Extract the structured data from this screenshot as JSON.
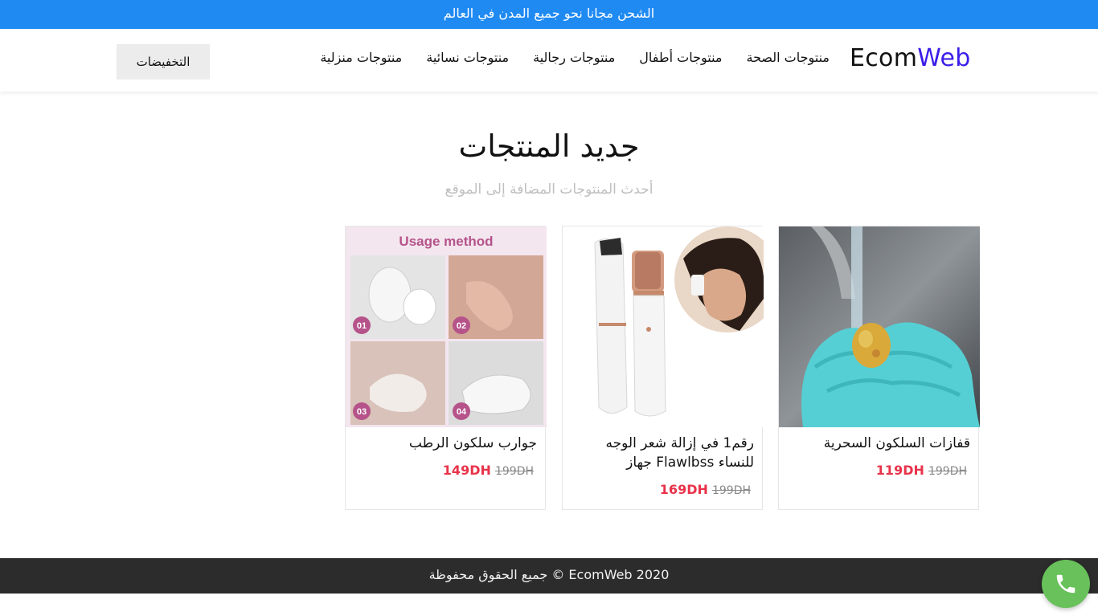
{
  "topbar": {
    "text": "الشحن مجانا نحو جميع المدن في العالم"
  },
  "header": {
    "logo_part1": "Ecom",
    "logo_part2": "Web",
    "nav": [
      "منتوجات منزلية",
      "منتوجات نسائية",
      "منتوجات رجالية",
      "منتوجات أطفال",
      "منتوجات الصحة"
    ],
    "sale_label": "التخفيضات"
  },
  "section": {
    "title": "جديد المنتجات",
    "subtitle": "أحدث المنتوجات المضافة إلى الموقع"
  },
  "products": [
    {
      "name": "قفازات السلكون السحرية",
      "price": "119DH",
      "old_price": "199DH",
      "image": "blue-silicone-glove-photo"
    },
    {
      "name": "رقم1 في إزالة شعر الوجه للنساء Flawlbss جهاز",
      "price": "169DH",
      "old_price": "199DH",
      "image": "facial-hair-remover-photo"
    },
    {
      "name": "جوارب سلكون الرطب",
      "price": "149DH",
      "old_price": "199DH",
      "image": "silicone-heel-socks-photo",
      "image_text": {
        "heading": "Usage method",
        "steps": [
          "01",
          "02",
          "03",
          "04"
        ]
      }
    }
  ],
  "footer": {
    "text": "جميع الحقوق محفوظة © EcomWeb 2020"
  },
  "colors": {
    "topbar": "#1f8af2",
    "logo_accent": "#3b1ee8",
    "price": "#e8334a",
    "footer": "#2c2c2c",
    "phone": "#68c15a"
  },
  "icons": {
    "call": "phone-icon"
  }
}
